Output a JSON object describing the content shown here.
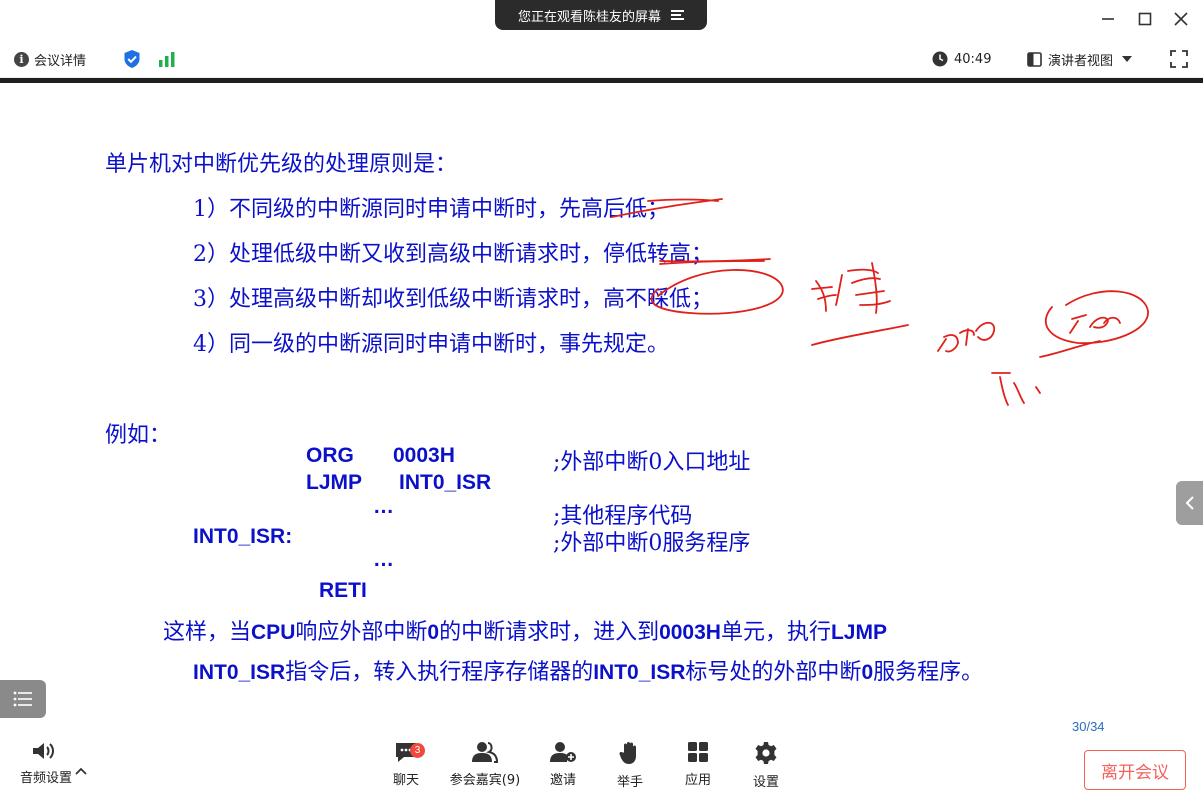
{
  "window": {
    "share_banner": "您正在观看陈桂友的屏幕"
  },
  "infobar": {
    "meeting_details": "会议详情",
    "timer": "40:49",
    "view_mode": "演讲者视图"
  },
  "slide": {
    "heading": "单片机对中断优先级的处理原则是：",
    "rules": [
      "1）不同级的中断源同时申请中断时，先高后低；",
      "2）处理低级中断又收到高级中断请求时，停低转高；",
      "3）处理高级中断却收到低级中断请求时，高不睬低；",
      "4）同一级的中断源同时申请中断时，事先规定。"
    ],
    "example_label": "例如：",
    "code": {
      "org": "ORG",
      "org_addr": "0003H",
      "org_comment": ";外部中断0入口地址",
      "ljmp": "LJMP",
      "ljmp_target": "INT0_ISR",
      "ellipsis1": "…",
      "other_comment": ";其他程序代码",
      "isr_label": "INT0_ISR:",
      "isr_comment": ";外部中断0服务程序",
      "ellipsis2": "…",
      "reti": "RETI"
    },
    "explanation": {
      "line1": [
        {
          "text": "这样，当",
          "style": "cn"
        },
        {
          "text": "CPU",
          "style": "code"
        },
        {
          "text": "响应外部中断",
          "style": "cn"
        },
        {
          "text": "0",
          "style": "code"
        },
        {
          "text": "的中断请求时，进入到",
          "style": "cn"
        },
        {
          "text": "0003H",
          "style": "code"
        },
        {
          "text": "单元，执行",
          "style": "cn"
        },
        {
          "text": "LJMP",
          "style": "code"
        }
      ],
      "line2": [
        {
          "text": "INT0_ISR",
          "style": "code"
        },
        {
          "text": "指令后，转入执行程序存储器的",
          "style": "cn"
        },
        {
          "text": "INT0_ISR",
          "style": "code"
        },
        {
          "text": "标号处的外部中断",
          "style": "cn"
        },
        {
          "text": "0",
          "style": "code"
        },
        {
          "text": "服务程序。",
          "style": "cn"
        }
      ]
    },
    "page_number": "30/34",
    "ink_color": "#e0201a",
    "text_color": "#0b10c9"
  },
  "toolbar": {
    "audio_settings": "音频设置",
    "chat": "聊天",
    "chat_badge": "3",
    "participants": "参会嘉宾(9)",
    "invite": "邀请",
    "raise_hand": "举手",
    "apps": "应用",
    "settings": "设置",
    "leave": "离开会议"
  }
}
